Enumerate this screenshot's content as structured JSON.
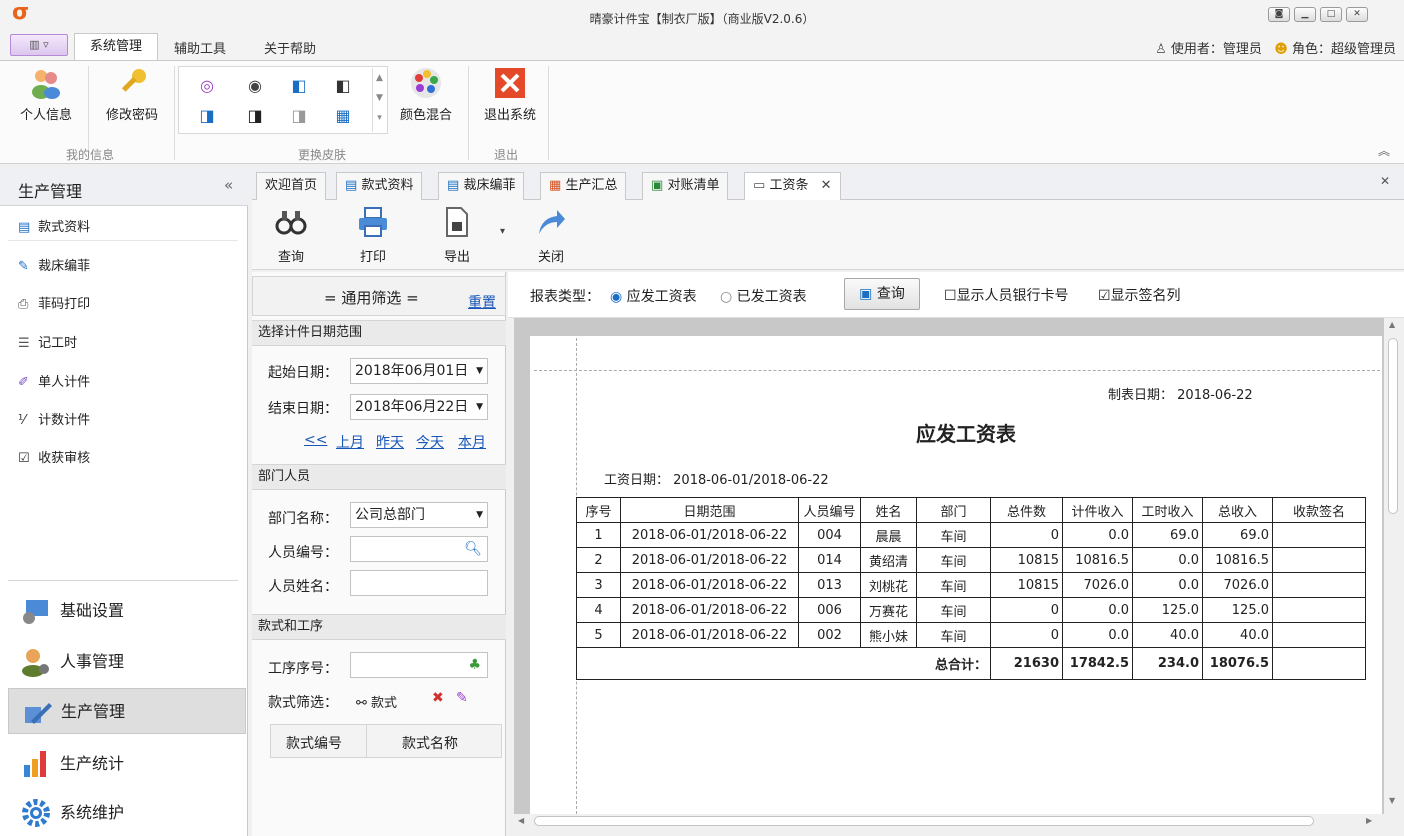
{
  "window": {
    "title": "晴豪计件宝【制衣厂版】（商业版V2.0.6）"
  },
  "ribbon_tabs": [
    "系统管理",
    "辅助工具",
    "关于帮助"
  ],
  "user": {
    "user_label": "使用者：管理员",
    "role_label": "角色：超级管理员"
  },
  "ribbon": {
    "personal_info": "个人信息",
    "change_password": "修改密码",
    "group_my_info": "我的信息",
    "color_mix": "颜色混合",
    "group_skin": "更换皮肤",
    "exit": "退出系统",
    "group_exit": "退出"
  },
  "leftnav": {
    "header": "生产管理",
    "collapse": "«",
    "items": [
      "款式资料",
      "裁床编菲",
      "菲码打印",
      "记工时",
      "单人计件",
      "计数计件",
      "收获审核"
    ],
    "groups": [
      "基础设置",
      "人事管理",
      "生产管理",
      "生产统计",
      "系统维护"
    ]
  },
  "doctabs": [
    "欢迎首页",
    "款式资料",
    "裁床编菲",
    "生产汇总",
    "对账清单",
    "工资条"
  ],
  "toolbar": {
    "query": "查询",
    "print": "打印",
    "export": "导出",
    "close": "关闭"
  },
  "filter": {
    "title": "= 通用筛选 =",
    "reset": "重置",
    "date_section": "选择计件日期范围",
    "start_label": "起始日期：",
    "start_value": "2018年06月01日",
    "end_label": "结束日期：",
    "end_value": "2018年06月22日",
    "quick_links": [
      "<<",
      "上月",
      "昨天",
      "今天",
      "本月"
    ],
    "dept_section": "部门人员",
    "dept_label": "部门名称：",
    "dept_value": "公司总部门",
    "staff_no_label": "人员编号：",
    "staff_name_label": "人员姓名：",
    "style_section": "款式和工序",
    "proc_no_label": "工序序号：",
    "style_filter_label": "款式筛选：",
    "style_btn": "款式",
    "grid_headers": [
      "款式编号",
      "款式名称"
    ]
  },
  "query": {
    "report_type_label": "报表类型：",
    "opt_payable": "应发工资表",
    "opt_paid": "已发工资表",
    "query_btn": "查询",
    "show_bank": "显示人员银行卡号",
    "show_sign": "显示签名列",
    "show_bank_checked": false,
    "show_sign_checked": true
  },
  "report": {
    "made_date_label": "制表日期：",
    "made_date": "2018-06-22",
    "title": "应发工资表",
    "wage_date_label": "工资日期：",
    "wage_date": "2018-06-01/2018-06-22",
    "headers": [
      "序号",
      "日期范围",
      "人员编号",
      "姓名",
      "部门",
      "总件数",
      "计件收入",
      "工时收入",
      "总收入",
      "收款签名"
    ],
    "rows": [
      [
        "1",
        "2018-06-01/2018-06-22",
        "004",
        "晨晨",
        "车间",
        "0",
        "0.0",
        "69.0",
        "69.0",
        ""
      ],
      [
        "2",
        "2018-06-01/2018-06-22",
        "014",
        "黄绍清",
        "车间",
        "10815",
        "10816.5",
        "0.0",
        "10816.5",
        ""
      ],
      [
        "3",
        "2018-06-01/2018-06-22",
        "013",
        "刘桃花",
        "车间",
        "10815",
        "7026.0",
        "0.0",
        "7026.0",
        ""
      ],
      [
        "4",
        "2018-06-01/2018-06-22",
        "006",
        "万赛花",
        "车间",
        "0",
        "0.0",
        "125.0",
        "125.0",
        ""
      ],
      [
        "5",
        "2018-06-01/2018-06-22",
        "002",
        "熊小妹",
        "车间",
        "0",
        "0.0",
        "40.0",
        "40.0",
        ""
      ]
    ],
    "total_label": "总合计：",
    "totals": [
      "21630",
      "17842.5",
      "234.0",
      "18076.5"
    ]
  }
}
